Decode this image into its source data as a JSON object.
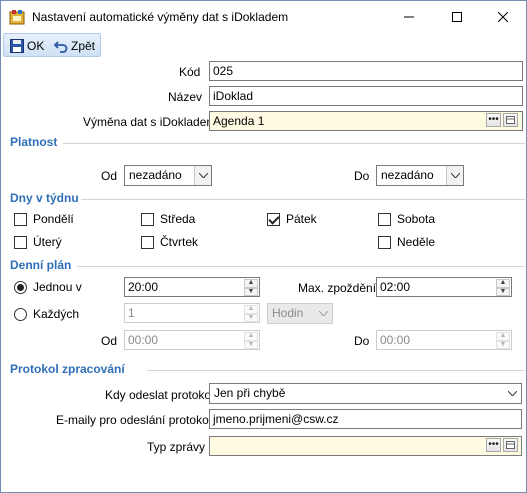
{
  "window": {
    "title": "Nastavení automatické výměny dat s iDokladem",
    "icon": "app-icon"
  },
  "toolbar": {
    "ok_label": "OK",
    "back_label": "Zpět"
  },
  "form": {
    "kod_label": "Kód",
    "kod_value": "025",
    "nazev_label": "Název",
    "nazev_value": "iDoklad",
    "vymena_label": "Výměna dat s iDokladem",
    "vymena_value": "Agenda 1"
  },
  "platnost": {
    "section_title": "Platnost",
    "od_label": "Od",
    "od_value": "nezadáno",
    "do_label": "Do",
    "do_value": "nezadáno"
  },
  "dny": {
    "section_title": "Dny v týdnu",
    "days": [
      {
        "label": "Pondělí",
        "checked": false
      },
      {
        "label": "Středa",
        "checked": false
      },
      {
        "label": "Pátek",
        "checked": true
      },
      {
        "label": "Sobota",
        "checked": false
      },
      {
        "label": "Úterý",
        "checked": false
      },
      {
        "label": "Čtvrtek",
        "checked": false
      },
      {
        "label": "Neděle",
        "checked": false
      }
    ]
  },
  "plan": {
    "section_title": "Denní plán",
    "jednou_label": "Jednou v",
    "jednou_value": "20:00",
    "jednou_selected": true,
    "max_label": "Max. zpoždění",
    "max_value": "02:00",
    "kazdych_label": "Každých",
    "kazdych_value": "1",
    "unit_value": "Hodin",
    "od_label": "Od",
    "od_value": "00:00",
    "do_label": "Do",
    "do_value": "00:00"
  },
  "protokol": {
    "section_title": "Protokol zpracování",
    "kdy_label": "Kdy odeslat protokol",
    "kdy_value": "Jen při chybě",
    "emaily_label": "E-maily pro odeslání protokolu",
    "emaily_value": "jmeno.prijmeni@csw.cz",
    "typ_label": "Typ zprávy",
    "typ_value": ""
  },
  "colors": {
    "section": "#2f6fb7",
    "lookup_bg": "#fffbe3",
    "toolbar_bg": "#cfe0f5"
  }
}
